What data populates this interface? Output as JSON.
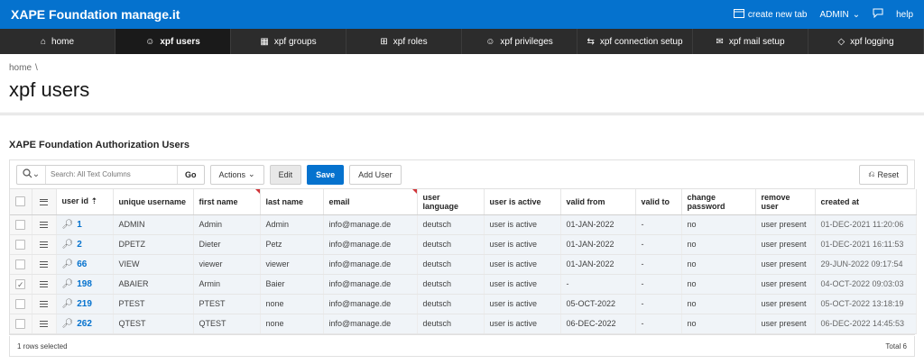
{
  "app": {
    "title": "XAPE Foundation manage.it"
  },
  "topbar": {
    "create_tab": "create new tab",
    "user": "ADMIN",
    "help": "help"
  },
  "nav": [
    {
      "label": "home",
      "icon": "home-icon"
    },
    {
      "label": "xpf users",
      "icon": "users-icon"
    },
    {
      "label": "xpf groups",
      "icon": "groups-icon"
    },
    {
      "label": "xpf roles",
      "icon": "roles-icon"
    },
    {
      "label": "xpf privileges",
      "icon": "privileges-icon"
    },
    {
      "label": "xpf connection setup",
      "icon": "connection-icon"
    },
    {
      "label": "xpf mail setup",
      "icon": "mail-icon"
    },
    {
      "label": "xpf logging",
      "icon": "logging-icon"
    }
  ],
  "breadcrumb": {
    "home": "home",
    "separator": "\\"
  },
  "page": {
    "title": "xpf users"
  },
  "region": {
    "title": "XAPE Foundation Authorization Users"
  },
  "toolbar": {
    "search_placeholder": "Search: All Text Columns",
    "go": "Go",
    "actions": "Actions",
    "edit": "Edit",
    "save": "Save",
    "add_user": "Add User",
    "reset": "Reset"
  },
  "columns": [
    "user id",
    "unique username",
    "first name",
    "last name",
    "email",
    "user language",
    "user is active",
    "valid from",
    "valid to",
    "change password",
    "remove user",
    "created at"
  ],
  "rows": [
    {
      "id": "1",
      "username": "ADMIN",
      "first": "Admin",
      "last": "Admin",
      "email": "info@manage.de",
      "lang": "deutsch",
      "active": "user is active",
      "from": "01-JAN-2022",
      "to": "-",
      "pw": "no",
      "remove": "user present",
      "created": "01-DEC-2021 11:20:06",
      "selected": false
    },
    {
      "id": "2",
      "username": "DPETZ",
      "first": "Dieter",
      "last": "Petz",
      "email": "info@manage.de",
      "lang": "deutsch",
      "active": "user is active",
      "from": "01-JAN-2022",
      "to": "-",
      "pw": "no",
      "remove": "user present",
      "created": "01-DEC-2021 16:11:53",
      "selected": false
    },
    {
      "id": "66",
      "username": "VIEW",
      "first": "viewer",
      "last": "viewer",
      "email": "info@manage.de",
      "lang": "deutsch",
      "active": "user is active",
      "from": "01-JAN-2022",
      "to": "-",
      "pw": "no",
      "remove": "user present",
      "created": "29-JUN-2022 09:17:54",
      "selected": false
    },
    {
      "id": "198",
      "username": "ABAIER",
      "first": "Armin",
      "last": "Baier",
      "email": "info@manage.de",
      "lang": "deutsch",
      "active": "user is active",
      "from": "-",
      "to": "-",
      "pw": "no",
      "remove": "user present",
      "created": "04-OCT-2022 09:03:03",
      "selected": true
    },
    {
      "id": "219",
      "username": "PTEST",
      "first": "PTEST",
      "last": "none",
      "email": "info@manage.de",
      "lang": "deutsch",
      "active": "user is active",
      "from": "05-OCT-2022",
      "to": "-",
      "pw": "no",
      "remove": "user present",
      "created": "05-OCT-2022 13:18:19",
      "selected": false
    },
    {
      "id": "262",
      "username": "QTEST",
      "first": "QTEST",
      "last": "none",
      "email": "info@manage.de",
      "lang": "deutsch",
      "active": "user is active",
      "from": "06-DEC-2022",
      "to": "-",
      "pw": "no",
      "remove": "user present",
      "created": "06-DEC-2022 14:45:53",
      "selected": false
    }
  ],
  "footer": {
    "selected": "1 rows selected",
    "total": "Total 6"
  }
}
